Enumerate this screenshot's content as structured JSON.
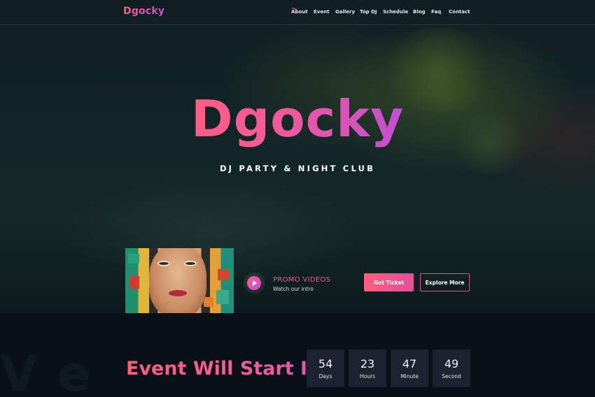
{
  "brand": {
    "logo": "Dgocky"
  },
  "nav": {
    "items": [
      "About",
      "Event",
      "Gallery",
      "Top DJ",
      "Schedule",
      "Blog",
      "Faq",
      "Contact"
    ],
    "active": "About"
  },
  "hero": {
    "title": "Dgocky",
    "subtitle": "DJ PARTY & NIGHT CLUB"
  },
  "promo": {
    "title": "PROMO VIDEOS",
    "subtitle": "Watch our intro",
    "play_icon": "play-icon",
    "ticket_button": "Get Ticket",
    "explore_button": "Explore More"
  },
  "countdown": {
    "heading": "Event Will Start In",
    "units": [
      {
        "value": "54",
        "label": "Days"
      },
      {
        "value": "23",
        "label": "Hours"
      },
      {
        "value": "47",
        "label": "Minute"
      },
      {
        "value": "49",
        "label": "Second"
      }
    ]
  },
  "colors": {
    "accent_start": "#ff5c8a",
    "accent_end": "#c64fd0",
    "background": "#0a1119"
  }
}
